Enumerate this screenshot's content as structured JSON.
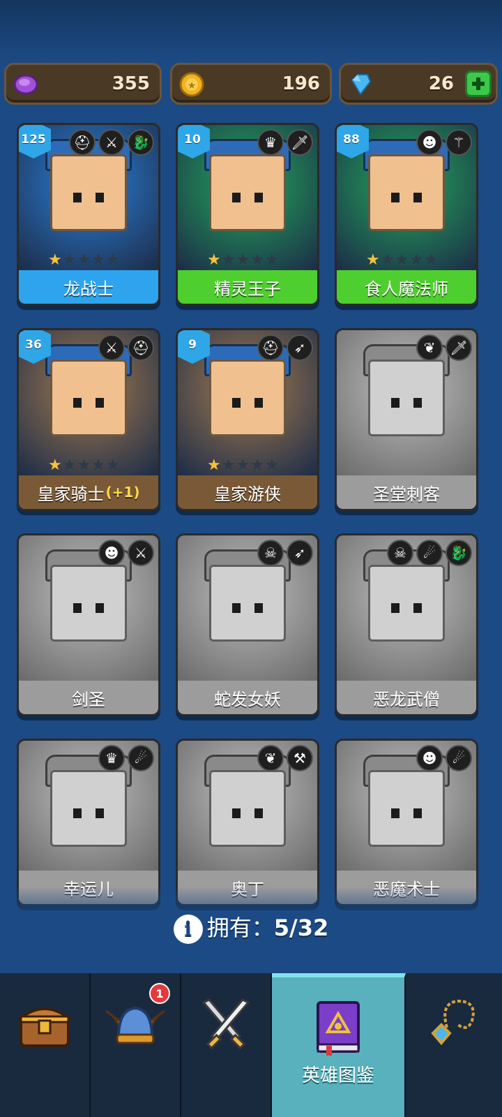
{
  "currencies": {
    "gems_purple": "355",
    "coins": "196",
    "diamonds": "26"
  },
  "heroes": [
    {
      "name": "龙战士",
      "level": "125",
      "stars": 1,
      "bonus": "",
      "unlocked": true,
      "icons": [
        "helmet-icon",
        "sword-icon",
        "dragon-icon"
      ],
      "bar_color": "#2ea4ee",
      "bg": "#2b7fd8"
    },
    {
      "name": "精灵王子",
      "level": "10",
      "stars": 1,
      "bonus": "",
      "unlocked": true,
      "icons": [
        "elf-icon",
        "dagger-icon"
      ],
      "bar_color": "#4fce2f",
      "bg": "#22a85a"
    },
    {
      "name": "食人魔法师",
      "level": "88",
      "stars": 1,
      "bonus": "",
      "unlocked": true,
      "icons": [
        "ogre-icon",
        "staff-icon"
      ],
      "bar_color": "#4fce2f",
      "bg": "#22a85a"
    },
    {
      "name": "皇家骑士",
      "level": "36",
      "stars": 1,
      "bonus": "(+1)",
      "unlocked": true,
      "icons": [
        "sword-icon",
        "helmet-icon"
      ],
      "bar_color": "#7a5a36",
      "bg": "#a27a4e"
    },
    {
      "name": "皇家游侠",
      "level": "9",
      "stars": 1,
      "bonus": "",
      "unlocked": true,
      "icons": [
        "helmet-icon",
        "bow-icon"
      ],
      "bar_color": "#7a5a36",
      "bg": "#a27a4e"
    },
    {
      "name": "圣堂刺客",
      "level": "",
      "stars": 0,
      "bonus": "",
      "unlocked": false,
      "icons": [
        "wings-icon",
        "dagger-icon"
      ]
    },
    {
      "name": "剑圣",
      "level": "",
      "stars": 0,
      "bonus": "",
      "unlocked": false,
      "icons": [
        "ogre-icon",
        "sword-icon"
      ]
    },
    {
      "name": "蛇发女妖",
      "level": "",
      "stars": 0,
      "bonus": "",
      "unlocked": false,
      "icons": [
        "skull-icon",
        "bow-icon"
      ]
    },
    {
      "name": "恶龙武僧",
      "level": "",
      "stars": 0,
      "bonus": "",
      "unlocked": false,
      "icons": [
        "skull-icon",
        "spirit-icon",
        "dragon-icon"
      ]
    },
    {
      "name": "幸运儿",
      "level": "",
      "stars": 0,
      "bonus": "",
      "unlocked": false,
      "icons": [
        "elf-icon",
        "spirit-icon"
      ]
    },
    {
      "name": "奥丁",
      "level": "",
      "stars": 0,
      "bonus": "",
      "unlocked": false,
      "icons": [
        "wings-icon",
        "hammer-icon"
      ]
    },
    {
      "name": "恶魔术士",
      "level": "",
      "stars": 0,
      "bonus": "",
      "unlocked": false,
      "icons": [
        "ogre-icon",
        "spirit-icon"
      ]
    }
  ],
  "owned": {
    "label": "拥有：",
    "count": "5/32"
  },
  "nav": {
    "tabs": [
      {
        "name": "chest-icon",
        "label": ""
      },
      {
        "name": "viking-helmet-icon",
        "label": "",
        "badge": "1"
      },
      {
        "name": "crossed-swords-icon",
        "label": ""
      },
      {
        "name": "hero-book-icon",
        "label": "英雄图鉴",
        "active": true
      },
      {
        "name": "amulet-icon",
        "label": ""
      }
    ]
  },
  "colors": {
    "background": "#1c4a84",
    "active_tab": "#58b1bc",
    "star_on": "#f7c23b"
  }
}
